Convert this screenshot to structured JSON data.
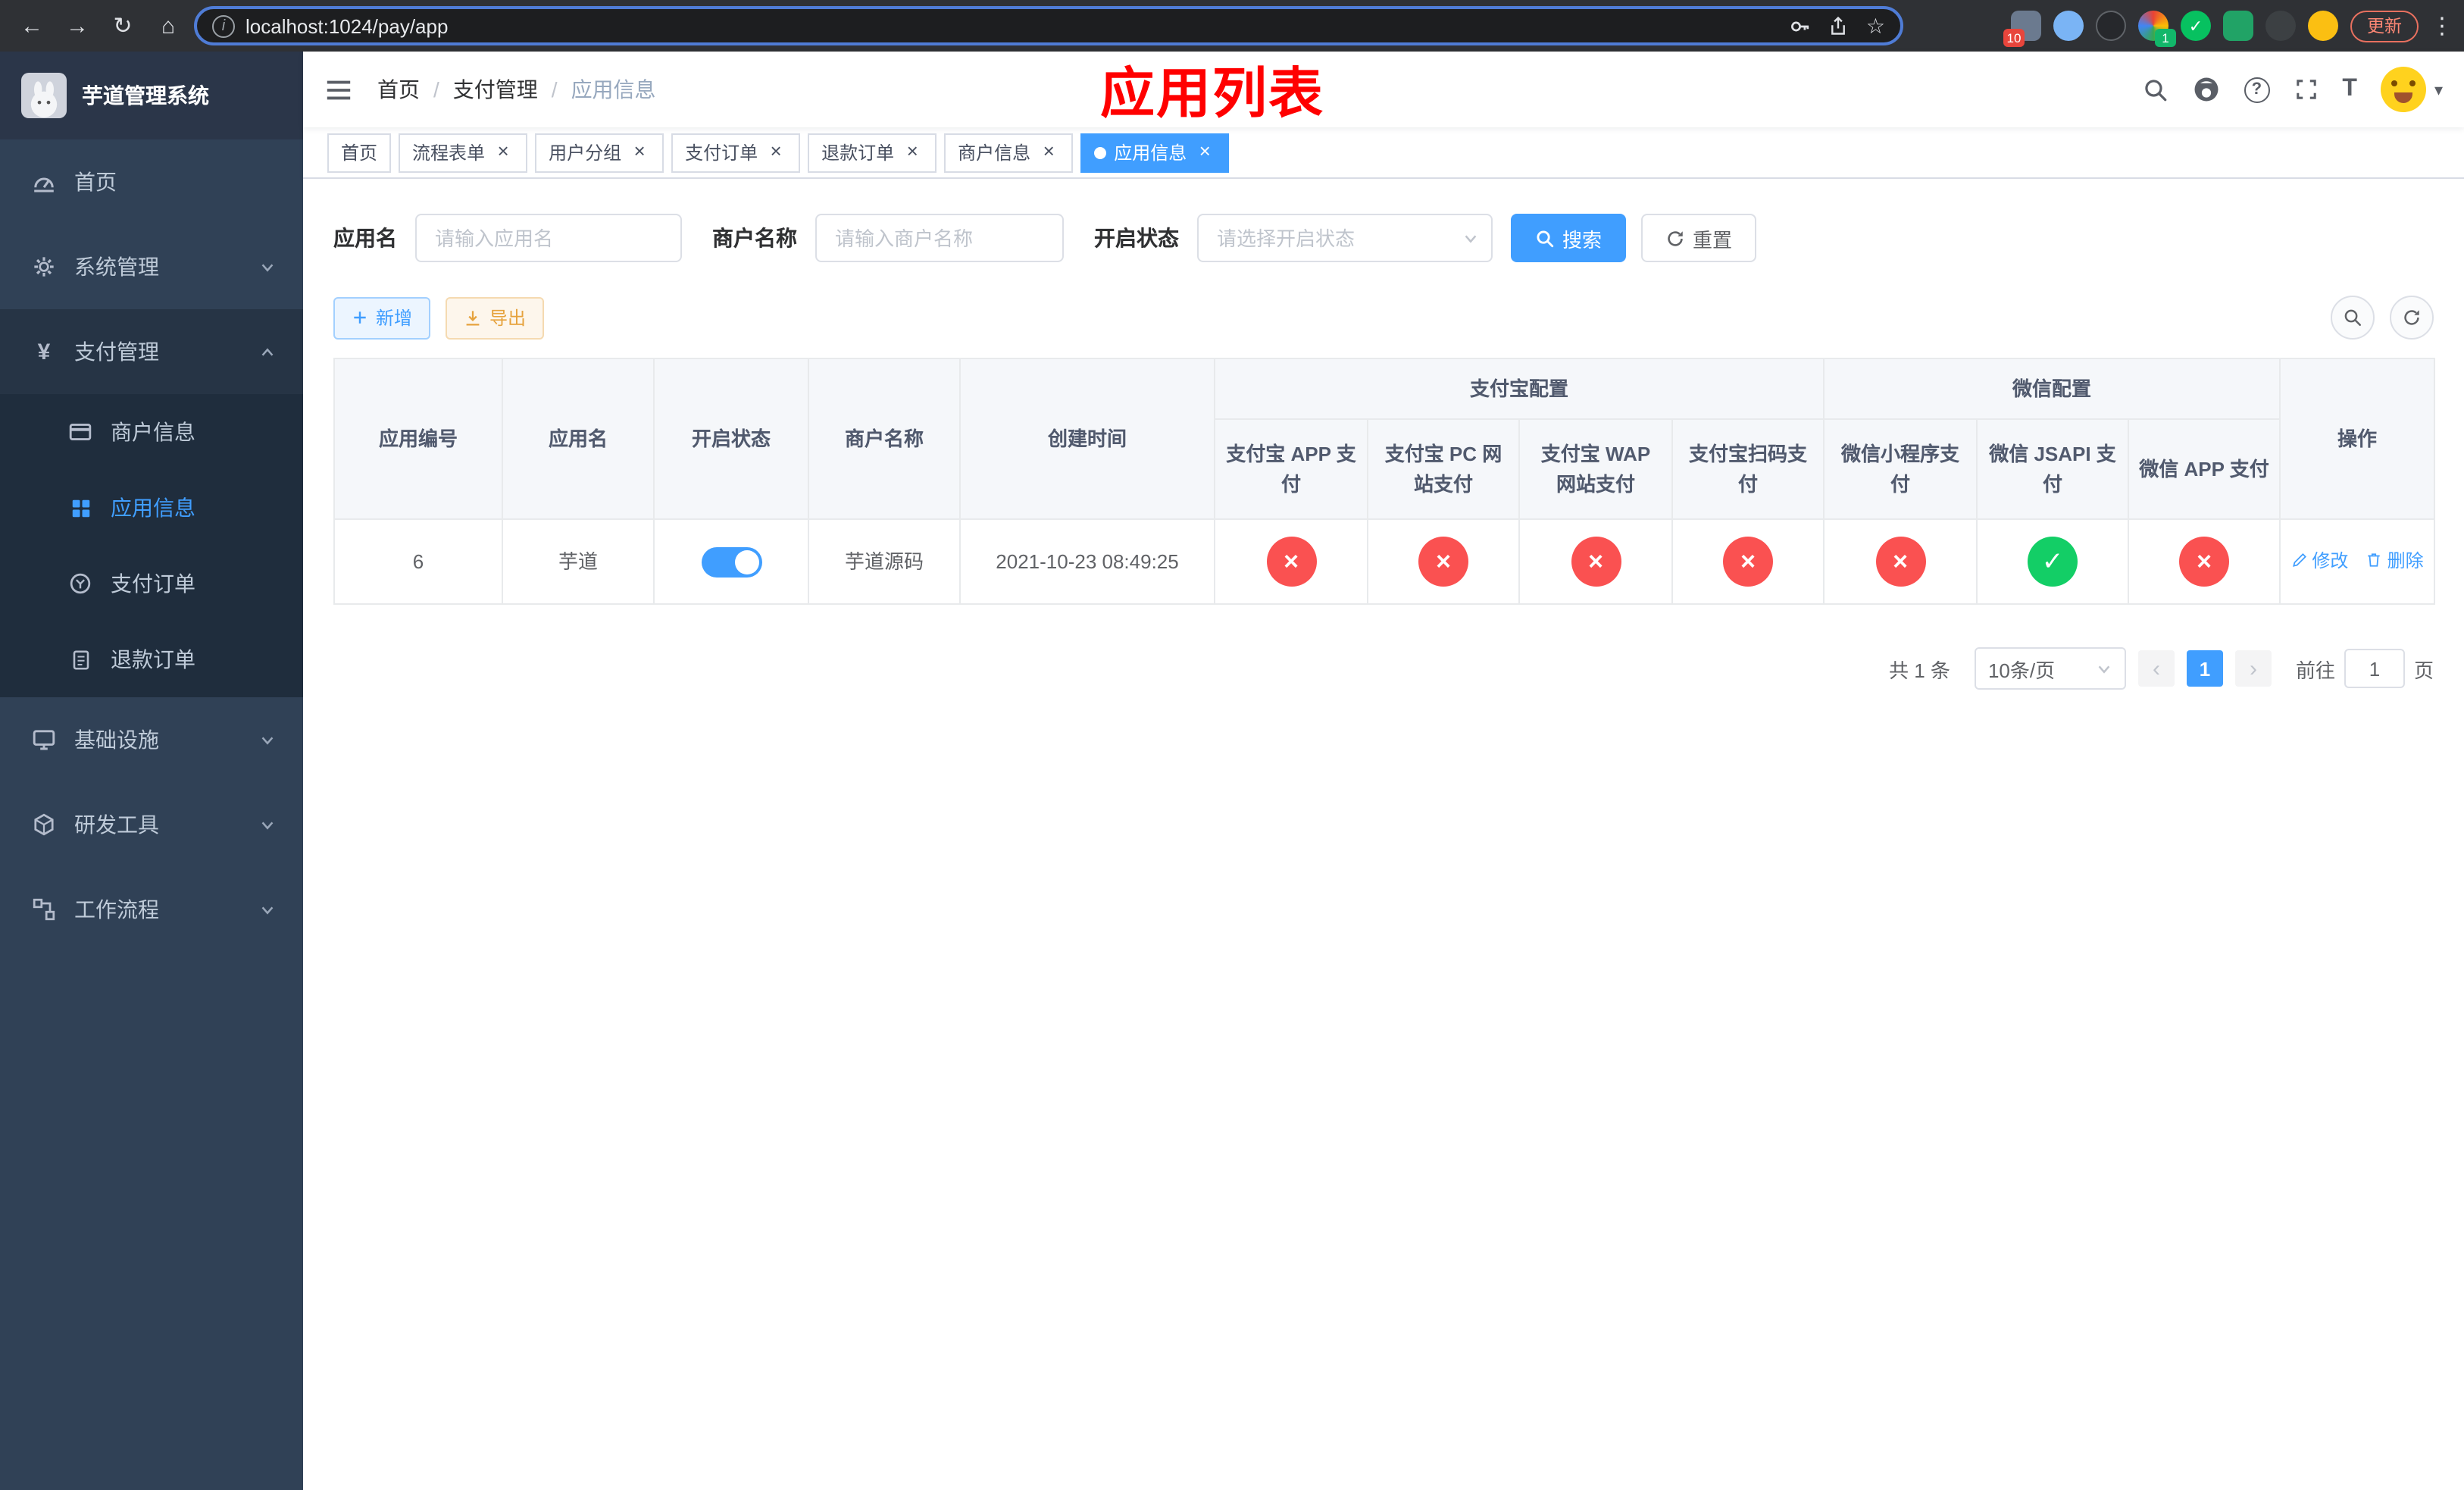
{
  "colors": {
    "primary": "#409eff",
    "success": "#13ce66",
    "danger": "#fa5151",
    "warning": "#e6a23c",
    "sidebar_bg": "#304156",
    "sidebar_submenu_bg": "#1f2d3d",
    "annotation_red": "#ff0000"
  },
  "browser": {
    "url": "localhost:1024/pay/app",
    "update_label": "更新",
    "extension_badge_count": "10",
    "profile_badge_count": "1"
  },
  "icons": {
    "back": "←",
    "forward": "→",
    "reload": "↻",
    "home": "⌂",
    "info": "i",
    "star": "☆",
    "menu_dots": "⋮",
    "help": "?",
    "caret_down": "▾",
    "prev": "‹",
    "next": "›",
    "close": "×",
    "fail": "×",
    "success": "✓",
    "yen": "¥",
    "font_size": "T"
  },
  "sidebar": {
    "app_title": "芋道管理系统",
    "items": {
      "home": "首页",
      "system": "系统管理",
      "payment": "支付管理",
      "merchant_info": "商户信息",
      "app_info": "应用信息",
      "pay_order": "支付订单",
      "refund_order": "退款订单",
      "infra": "基础设施",
      "dev_tools": "研发工具",
      "workflow": "工作流程"
    }
  },
  "navbar": {
    "breadcrumb": {
      "home": "首页",
      "section": "支付管理",
      "current": "应用信息",
      "separator": "/"
    },
    "overlay_title": "应用列表"
  },
  "tabs": [
    {
      "label": "首页",
      "closable": false,
      "active": false
    },
    {
      "label": "流程表单",
      "closable": true,
      "active": false
    },
    {
      "label": "用户分组",
      "closable": true,
      "active": false
    },
    {
      "label": "支付订单",
      "closable": true,
      "active": false
    },
    {
      "label": "退款订单",
      "closable": true,
      "active": false
    },
    {
      "label": "商户信息",
      "closable": true,
      "active": false
    },
    {
      "label": "应用信息",
      "closable": true,
      "active": true
    }
  ],
  "filters": {
    "app_name": {
      "label": "应用名",
      "placeholder": "请输入应用名",
      "value": ""
    },
    "merchant_name": {
      "label": "商户名称",
      "placeholder": "请输入商户名称",
      "value": ""
    },
    "status": {
      "label": "开启状态",
      "placeholder": "请选择开启状态",
      "value": ""
    },
    "search_label": "搜索",
    "reset_label": "重置"
  },
  "toolbar": {
    "add_label": "新增",
    "export_label": "导出"
  },
  "table": {
    "headers": {
      "app_id": "应用编号",
      "app_name": "应用名",
      "status": "开启状态",
      "merchant_name": "商户名称",
      "created_at": "创建时间",
      "alipay_group": "支付宝配置",
      "wechat_group": "微信配置",
      "alipay_app": "支付宝 APP 支付",
      "alipay_pc": "支付宝 PC 网站支付",
      "alipay_wap": "支付宝 WAP 网站支付",
      "alipay_qr": "支付宝扫码支付",
      "wechat_lite": "微信小程序支付",
      "wechat_jsapi": "微信 JSAPI 支付",
      "wechat_app": "微信 APP 支付",
      "actions": "操作"
    },
    "rows": [
      {
        "app_id": "6",
        "app_name": "芋道",
        "status_enabled": true,
        "merchant_name": "芋道源码",
        "created_at": "2021-10-23 08:49:25",
        "configs": {
          "alipay_app": false,
          "alipay_pc": false,
          "alipay_wap": false,
          "alipay_qr": false,
          "wechat_lite": false,
          "wechat_jsapi": true,
          "wechat_app": false
        },
        "edit_label": "修改",
        "delete_label": "删除"
      }
    ]
  },
  "pagination": {
    "total_text": "共 1 条",
    "page_size_text": "10条/页",
    "current_page": "1",
    "goto_label": "前往",
    "goto_value": "1",
    "page_unit": "页"
  }
}
